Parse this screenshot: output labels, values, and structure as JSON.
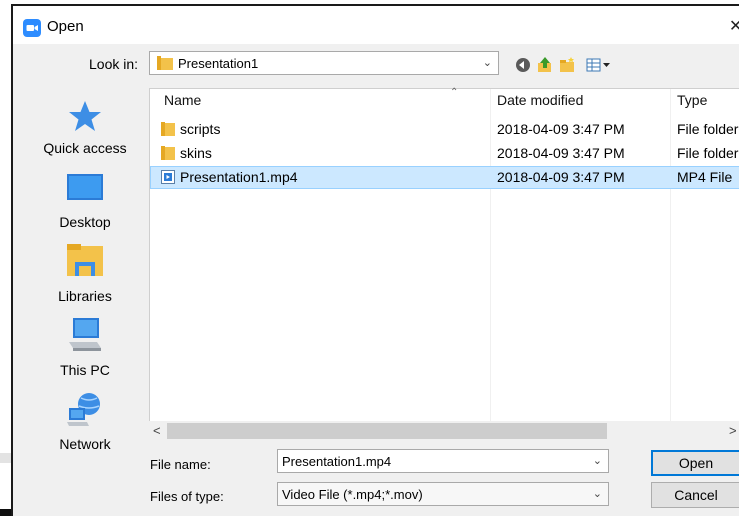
{
  "window": {
    "title": "Open",
    "close_glyph": "✕"
  },
  "toolbar": {
    "look_in_label": "Look in:",
    "look_in_value": "Presentation1",
    "icons": [
      "back-icon",
      "up-folder-icon",
      "new-folder-icon",
      "view-menu-icon"
    ]
  },
  "places": [
    {
      "label": "Quick access",
      "icon": "star-icon"
    },
    {
      "label": "Desktop",
      "icon": "desktop-icon"
    },
    {
      "label": "Libraries",
      "icon": "libraries-icon"
    },
    {
      "label": "This PC",
      "icon": "computer-icon"
    },
    {
      "label": "Network",
      "icon": "network-icon"
    }
  ],
  "file_list": {
    "columns": [
      "Name",
      "Date modified",
      "Type"
    ],
    "rows": [
      {
        "name": "scripts",
        "date": "2018-04-09 3:47 PM",
        "type": "File folder",
        "icon": "folder-icon",
        "selected": false
      },
      {
        "name": "skins",
        "date": "2018-04-09 3:47 PM",
        "type": "File folder",
        "icon": "folder-icon",
        "selected": false
      },
      {
        "name": "Presentation1.mp4",
        "date": "2018-04-09 3:47 PM",
        "type": "MP4 File",
        "icon": "video-file-icon",
        "selected": true
      }
    ]
  },
  "bottom": {
    "file_name_label": "File name:",
    "file_name_value": "Presentation1.mp4",
    "file_type_label": "Files of type:",
    "file_type_value": "Video File (*.mp4;*.mov)",
    "open_label": "Open",
    "cancel_label": "Cancel"
  },
  "colors": {
    "selection": "#cce8ff",
    "selection_border": "#99d1ff",
    "accent": "#0078d7"
  }
}
